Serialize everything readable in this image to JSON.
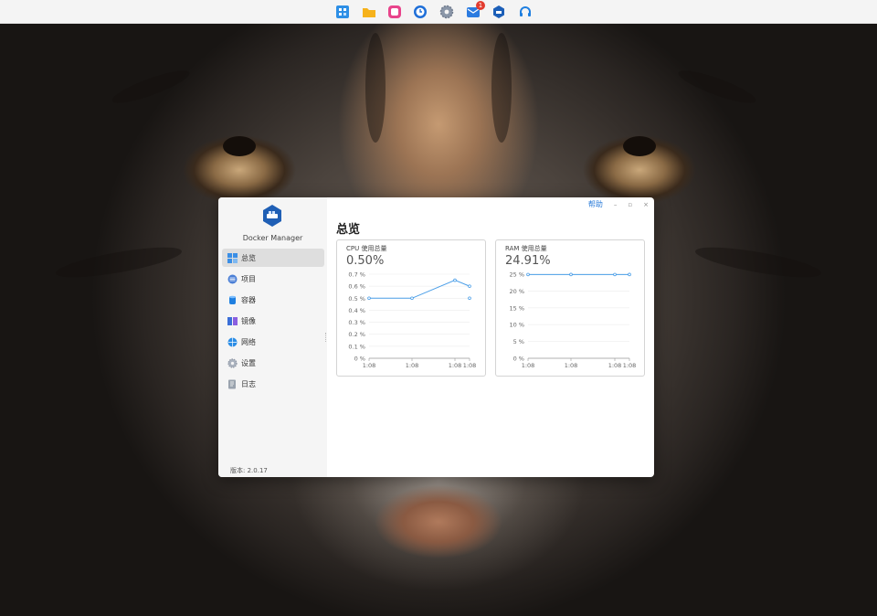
{
  "dock": {
    "items": [
      {
        "name": "app-grid",
        "color": "#2d8fe6"
      },
      {
        "name": "file-manager",
        "color": "#f6b21b"
      },
      {
        "name": "photos",
        "color": "#e8448b"
      },
      {
        "name": "backup-clock",
        "color": "#1f6fd8"
      },
      {
        "name": "settings-gear",
        "color": "#8a96a8"
      },
      {
        "name": "mail",
        "color": "#2b7be0",
        "badge": "1"
      },
      {
        "name": "docker-manager",
        "color": "#1c5fb8"
      },
      {
        "name": "support-headset",
        "color": "#1f7fe0"
      }
    ]
  },
  "window": {
    "help": "帮助",
    "minimize": "–",
    "maximize": "▫",
    "close": "×"
  },
  "app": {
    "name": "Docker Manager",
    "version": "版本: 2.0.17"
  },
  "sidebar": {
    "items": [
      {
        "label": "总览",
        "icon": "overview-icon",
        "active": true
      },
      {
        "label": "项目",
        "icon": "project-icon",
        "active": false
      },
      {
        "label": "容器",
        "icon": "container-icon",
        "active": false
      },
      {
        "label": "镜像",
        "icon": "image-icon",
        "active": false
      },
      {
        "label": "网络",
        "icon": "network-icon",
        "active": false
      },
      {
        "label": "设置",
        "icon": "settings-icon",
        "active": false
      },
      {
        "label": "日志",
        "icon": "log-icon",
        "active": false
      }
    ]
  },
  "main": {
    "title": "总览"
  },
  "chart_data": [
    {
      "type": "line",
      "title": "CPU 使用总量",
      "value_text": "0.50%",
      "x": [
        "1:08",
        "1:08",
        "1:08",
        "1:08"
      ],
      "series": [
        {
          "values": [
            0.5,
            0.5,
            0.65,
            0.6
          ]
        }
      ],
      "isolated_point": 0.5,
      "yticks": [
        "0 %",
        "0.1 %",
        "0.2 %",
        "0.3 %",
        "0.4 %",
        "0.5 %",
        "0.6 %",
        "0.7 %"
      ],
      "ylim": [
        0,
        0.7
      ],
      "color": "#4a9ee8",
      "grid": true
    },
    {
      "type": "line",
      "title": "RAM 使用总量",
      "value_text": "24.91%",
      "x": [
        "1:08",
        "1:08",
        "1:08",
        "1:08"
      ],
      "series": [
        {
          "values": [
            24.9,
            24.91,
            24.9,
            24.91
          ]
        }
      ],
      "yticks": [
        "0 %",
        "5 %",
        "10 %",
        "15 %",
        "20 %",
        "25 %"
      ],
      "ylim": [
        0,
        25
      ],
      "color": "#4a9ee8",
      "grid": true
    }
  ]
}
